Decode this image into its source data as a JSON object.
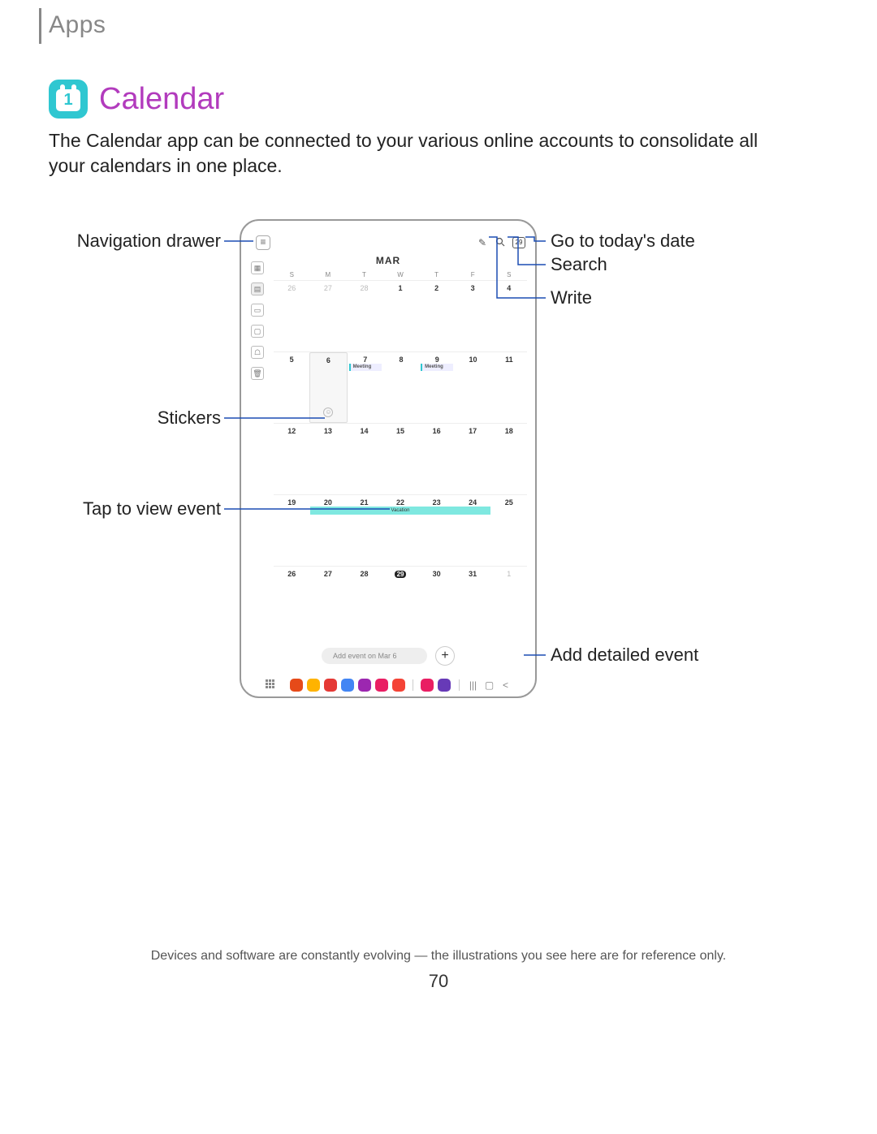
{
  "section": "Apps",
  "title": "Calendar",
  "intro": "The Calendar app can be connected to your various online accounts to consolidate all your calendars in one place.",
  "callouts": {
    "nav_drawer": "Navigation drawer",
    "today": "Go to today's date",
    "search": "Search",
    "write": "Write",
    "stickers": "Stickers",
    "view_event": "Tap to view event",
    "add_event": "Add detailed event"
  },
  "screenshot": {
    "month": "MAR",
    "today_date": "29",
    "dow": [
      "S",
      "M",
      "T",
      "W",
      "T",
      "F",
      "S"
    ],
    "weeks": [
      [
        "26",
        "27",
        "28",
        "1",
        "2",
        "3",
        "4"
      ],
      [
        "5",
        "6",
        "7",
        "8",
        "9",
        "10",
        "11"
      ],
      [
        "12",
        "13",
        "14",
        "15",
        "16",
        "17",
        "18"
      ],
      [
        "19",
        "20",
        "21",
        "22",
        "23",
        "24",
        "25"
      ],
      [
        "26",
        "27",
        "28",
        "29",
        "30",
        "31",
        "1"
      ]
    ],
    "events": {
      "meeting_label": "Meeting",
      "vacation_label": "Vacation"
    },
    "quick_add_placeholder": "Add event on Mar 6",
    "plus": "+",
    "dock_colors": [
      "#e64a19",
      "#ffb300",
      "#e53935",
      "#4285f4",
      "#9c27b0",
      "#e91e63",
      "#f44336",
      "#e91e63",
      "#673ab7"
    ]
  },
  "footnote": "Devices and software are constantly evolving — the illustrations you see here are for reference only.",
  "page_number": "70"
}
